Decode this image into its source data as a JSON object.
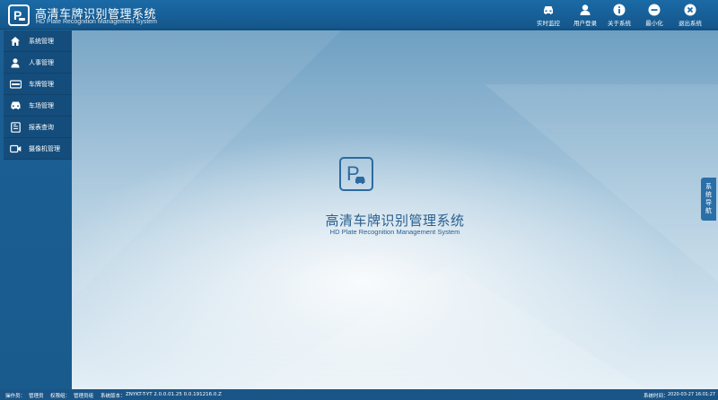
{
  "app": {
    "title_zh": "高清车牌识别管理系统",
    "title_en": "HD Plate Recognition Management System",
    "logo_letter": "P"
  },
  "toolbar": {
    "buttons": [
      {
        "label": "实时监控",
        "icon": "car-icon"
      },
      {
        "label": "用户登录",
        "icon": "user-icon"
      },
      {
        "label": "关于系统",
        "icon": "info-icon"
      },
      {
        "label": "最小化",
        "icon": "minimize-icon"
      },
      {
        "label": "退出系统",
        "icon": "close-icon"
      }
    ]
  },
  "sidebar": {
    "items": [
      {
        "label": "系统管理",
        "icon": "home-icon"
      },
      {
        "label": "人事管理",
        "icon": "person-icon"
      },
      {
        "label": "车牌管理",
        "icon": "plate-icon"
      },
      {
        "label": "车场管理",
        "icon": "car-icon"
      },
      {
        "label": "报表查询",
        "icon": "report-icon"
      },
      {
        "label": "摄像机管理",
        "icon": "camera-icon"
      }
    ]
  },
  "main": {
    "title_zh": "高清车牌识别管理系统",
    "title_en": "HD Plate Recognition Management System"
  },
  "nav_tab": {
    "chars": [
      "系",
      "统",
      "导",
      "航"
    ]
  },
  "statusbar": {
    "operator_label": "操作员：",
    "operator_value": "管理员",
    "permission_label": "权限组：",
    "permission_value": "管理员组",
    "version_label": "系统版本：",
    "version_value": "ZNYKT-T-YT 2.0.0.01.25 0.0.191216.0.Z",
    "time_label": "系统时间：",
    "time_value": "2020-03-27 16:01:27"
  },
  "colors": {
    "header_bg": "#1b6aa6",
    "sidebar_bg": "#1b5f95",
    "accent": "#2a5f8e"
  }
}
